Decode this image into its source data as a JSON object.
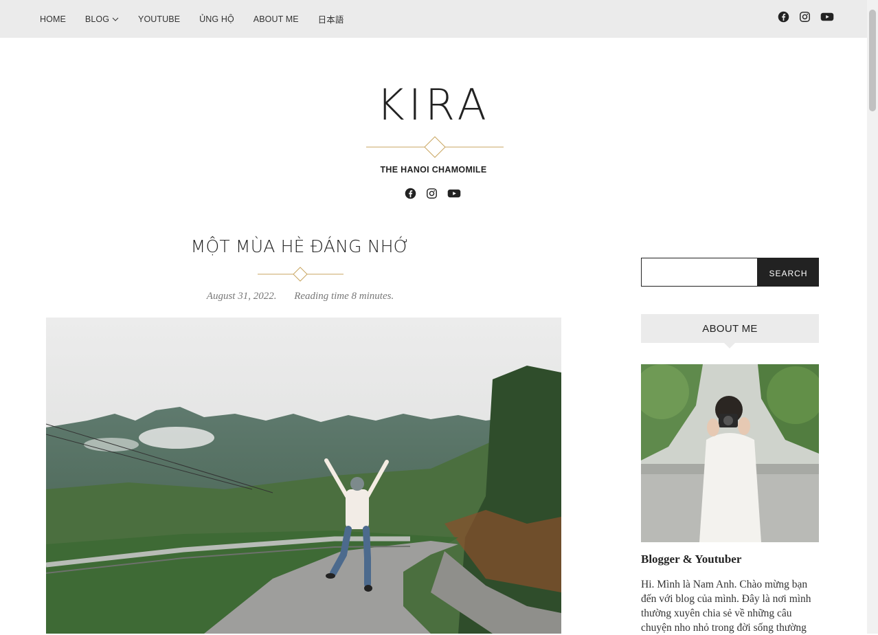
{
  "nav": {
    "items": [
      "HOME",
      "BLOG",
      "YOUTUBE",
      "ỦNG HỘ",
      "ABOUT ME",
      "日本語"
    ],
    "social_icons": [
      "facebook-icon",
      "instagram-icon",
      "youtube-icon"
    ]
  },
  "header": {
    "title": "KIRA",
    "tagline": "THE HANOI CHAMOMILE",
    "accent_color": "#c9a560"
  },
  "post": {
    "title": "MỘT MÙA HÈ ĐÁNG NHỚ",
    "date": "August 31, 2022.",
    "reading_time": "Reading time 8 minutes.",
    "hero_image": "mountain-road-jump-photo"
  },
  "sidebar": {
    "search": {
      "placeholder": "",
      "button_label": "SEARCH"
    },
    "about": {
      "heading": "ABOUT ME",
      "photo": "blogger-with-camera-photo",
      "name": "Blogger & Youtuber",
      "bio": "Hi. Mình là Nam Anh. Chào mừng bạn đến với blog của mình. Đây là nơi mình thường xuyên chia sẻ về những câu chuyện nho nhỏ trong đời sống thường"
    }
  }
}
